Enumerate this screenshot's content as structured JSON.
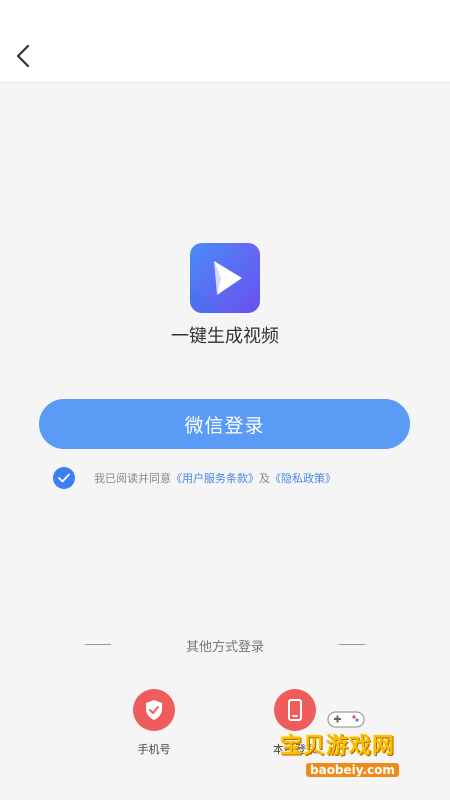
{
  "app": {
    "name": "一键生成视频"
  },
  "header": {
    "back_icon": "chevron-left-icon"
  },
  "login": {
    "wechat_button_label": "微信登录",
    "agreement": {
      "checked": true,
      "prefix": "我已阅读并同意",
      "terms_link": "《用户服务条款》",
      "conjunction": "及",
      "privacy_link": "《隐私政策》"
    }
  },
  "other_methods": {
    "title": "其他方式登录",
    "items": [
      {
        "label": "手机号",
        "icon": "shield-check-icon"
      },
      {
        "label": "本机登录",
        "icon": "mobile-phone-icon"
      }
    ]
  },
  "watermark": {
    "title": "宝贝游戏网",
    "url": "baobeiy.com"
  },
  "colors": {
    "primary": "#5a9bf5",
    "check": "#3d7ef1",
    "link": "#4a86e8",
    "method_icon_bg": "#ee5c5c",
    "logo_gradient_start": "#4f8df5",
    "logo_gradient_end": "#6a4ff0"
  }
}
